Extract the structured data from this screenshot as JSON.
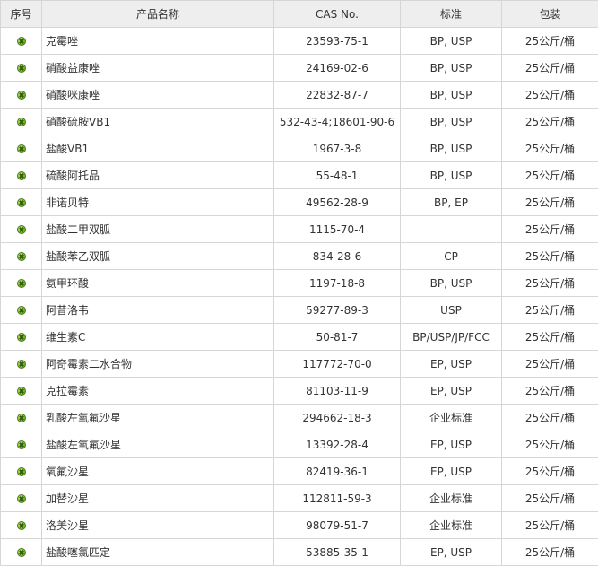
{
  "table": {
    "headers": {
      "index": "序号",
      "name": "产品名称",
      "cas": "CAS No.",
      "standard": "标准",
      "package": "包装"
    },
    "bullet_icon": "green-circle-x-icon",
    "bullet_color": "#7fbf2a",
    "rows": [
      {
        "name": "克霉唑",
        "cas": "23593-75-1",
        "standard": "BP, USP",
        "package": "25公斤/桶"
      },
      {
        "name": "硝酸益康唑",
        "cas": "24169-02-6",
        "standard": "BP, USP",
        "package": "25公斤/桶"
      },
      {
        "name": "硝酸咪康唑",
        "cas": "22832-87-7",
        "standard": "BP, USP",
        "package": "25公斤/桶"
      },
      {
        "name": "硝酸硫胺VB1",
        "cas": "532-43-4;18601-90-6",
        "standard": "BP, USP",
        "package": "25公斤/桶"
      },
      {
        "name": "盐酸VB1",
        "cas": "1967-3-8",
        "standard": "BP, USP",
        "package": "25公斤/桶"
      },
      {
        "name": "硫酸阿托品",
        "cas": "55-48-1",
        "standard": "BP, USP",
        "package": "25公斤/桶"
      },
      {
        "name": "非诺贝特",
        "cas": "49562-28-9",
        "standard": "BP, EP",
        "package": "25公斤/桶"
      },
      {
        "name": "盐酸二甲双胍",
        "cas": "1115-70-4",
        "standard": "",
        "package": "25公斤/桶"
      },
      {
        "name": "盐酸苯乙双胍",
        "cas": "834-28-6",
        "standard": "CP",
        "package": "25公斤/桶"
      },
      {
        "name": "氨甲环酸",
        "cas": "1197-18-8",
        "standard": "BP, USP",
        "package": "25公斤/桶"
      },
      {
        "name": "阿昔洛韦",
        "cas": "59277-89-3",
        "standard": "USP",
        "package": "25公斤/桶"
      },
      {
        "name": "维生素C",
        "cas": "50-81-7",
        "standard": "BP/USP/JP/FCC",
        "package": "25公斤/桶"
      },
      {
        "name": "阿奇霉素二水合物",
        "cas": "117772-70-0",
        "standard": "EP, USP",
        "package": "25公斤/桶"
      },
      {
        "name": "克拉霉素",
        "cas": "81103-11-9",
        "standard": "EP, USP",
        "package": "25公斤/桶"
      },
      {
        "name": "乳酸左氧氟沙星",
        "cas": "294662-18-3",
        "standard": "企业标准",
        "package": "25公斤/桶"
      },
      {
        "name": "盐酸左氧氟沙星",
        "cas": "13392-28-4",
        "standard": "EP, USP",
        "package": "25公斤/桶"
      },
      {
        "name": "氧氟沙星",
        "cas": "82419-36-1",
        "standard": "EP, USP",
        "package": "25公斤/桶"
      },
      {
        "name": "加替沙星",
        "cas": "112811-59-3",
        "standard": "企业标准",
        "package": "25公斤/桶"
      },
      {
        "name": "洛美沙星",
        "cas": "98079-51-7",
        "standard": "企业标准",
        "package": "25公斤/桶"
      },
      {
        "name": "盐酸噻氯匹定",
        "cas": "53885-35-1",
        "standard": "EP, USP",
        "package": "25公斤/桶"
      }
    ]
  }
}
